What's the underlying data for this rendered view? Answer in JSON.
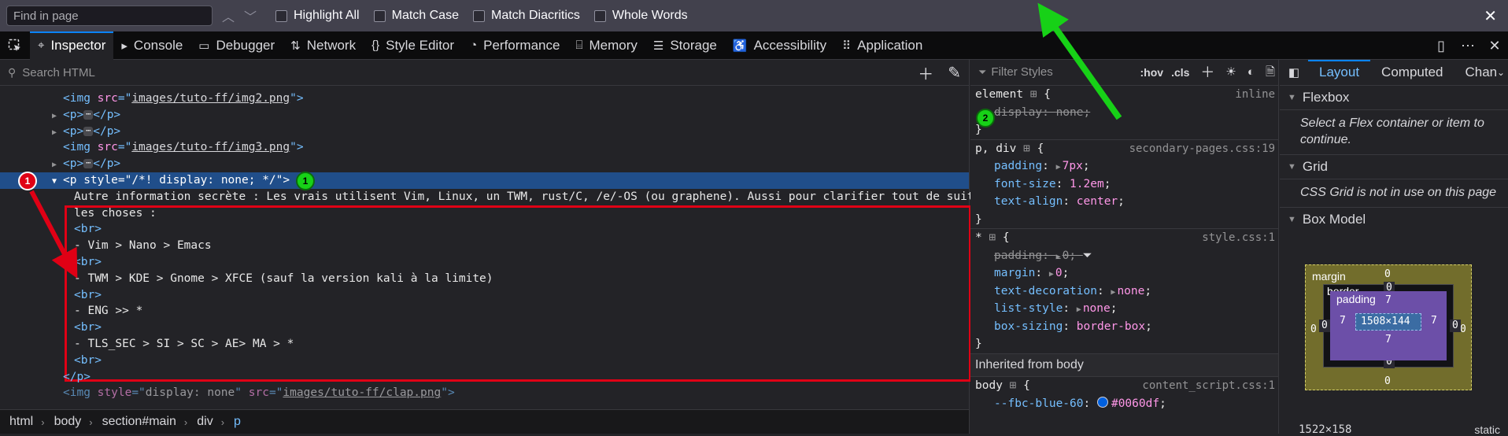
{
  "findbar": {
    "placeholder": "Find in page",
    "options": [
      "Highlight All",
      "Match Case",
      "Match Diacritics",
      "Whole Words"
    ]
  },
  "toolbox": {
    "tabs": [
      {
        "label": "Inspector",
        "icon": "inspector-icon"
      },
      {
        "label": "Console",
        "icon": "console-icon"
      },
      {
        "label": "Debugger",
        "icon": "debugger-icon"
      },
      {
        "label": "Network",
        "icon": "network-icon"
      },
      {
        "label": "Style Editor",
        "icon": "style-editor-icon"
      },
      {
        "label": "Performance",
        "icon": "performance-icon"
      },
      {
        "label": "Memory",
        "icon": "memory-icon"
      },
      {
        "label": "Storage",
        "icon": "storage-icon"
      },
      {
        "label": "Accessibility",
        "icon": "accessibility-icon"
      },
      {
        "label": "Application",
        "icon": "application-icon"
      }
    ]
  },
  "markup": {
    "search_placeholder": "Search HTML",
    "lines": {
      "l1_src": "images/tuto-ff/img2.png",
      "l4_src": "images/tuto-ff/img3.png",
      "sel_style": "/*! display: none; */",
      "text1": "Autre information secrète : Les vrais utilisent Vim, Linux, un TWM, rust/C, /e/-OS (ou graphene). Aussi pour clarifier tout de suite",
      "text2": "les choses :",
      "t_vim": "- Vim > Nano > Emacs",
      "t_twm": "- TWM > KDE > Gnome > XFCE (sauf la version kali à la limite)",
      "t_eng": "- ENG >> *",
      "t_tls": "- TLS_SEC > SI > SC > AE> MA > *",
      "last_style": "display: none",
      "last_src": "images/tuto-ff/clap.png"
    }
  },
  "breadcrumbs": [
    "html",
    "body",
    "section#main",
    "div",
    "p"
  ],
  "rules": {
    "filter_placeholder": "Filter Styles",
    "hov": ":hov",
    "cls": ".cls",
    "element": {
      "selector": "element",
      "source": "inline",
      "prop": "display",
      "value": "none"
    },
    "pdiv": {
      "selector": "p, div",
      "source": "secondary-pages.css:19",
      "props": [
        [
          "padding",
          "7px"
        ],
        [
          "font-size",
          "1.2em"
        ],
        [
          "text-align",
          "center"
        ]
      ]
    },
    "star": {
      "selector": "*",
      "source": "style.css:1",
      "props": [
        [
          "padding",
          "0"
        ],
        [
          "margin",
          "0"
        ],
        [
          "text-decoration",
          "none"
        ],
        [
          "list-style",
          "none"
        ],
        [
          "box-sizing",
          "border-box"
        ]
      ]
    },
    "inherited_label": "Inherited from body",
    "body": {
      "selector": "body",
      "source": "content_script.css:1",
      "prop": "--fbc-blue-60",
      "value": "#0060df"
    }
  },
  "side": {
    "tabs": [
      "Layout",
      "Computed",
      "Chan"
    ],
    "flexbox_title": "Flexbox",
    "flexbox_msg": "Select a Flex container or item to continue.",
    "grid_title": "Grid",
    "grid_msg": "CSS Grid is not in use on this page",
    "boxmodel_title": "Box Model",
    "bm": {
      "margin_label": "margin",
      "border_label": "border",
      "padding_label": "padding",
      "content": "1508×144",
      "m_top": "0",
      "m_bottom": "0",
      "m_left": "0",
      "m_right": "0",
      "b_top": "0",
      "b_bottom": "0",
      "b_left": "0",
      "b_right": "0",
      "p_top": "7",
      "p_bottom": "7",
      "p_left": "7",
      "p_right": "7"
    },
    "footer_size": "1522×158",
    "footer_pos": "static"
  },
  "annotations": {
    "red1": "1",
    "green1": "1",
    "green2": "2"
  }
}
